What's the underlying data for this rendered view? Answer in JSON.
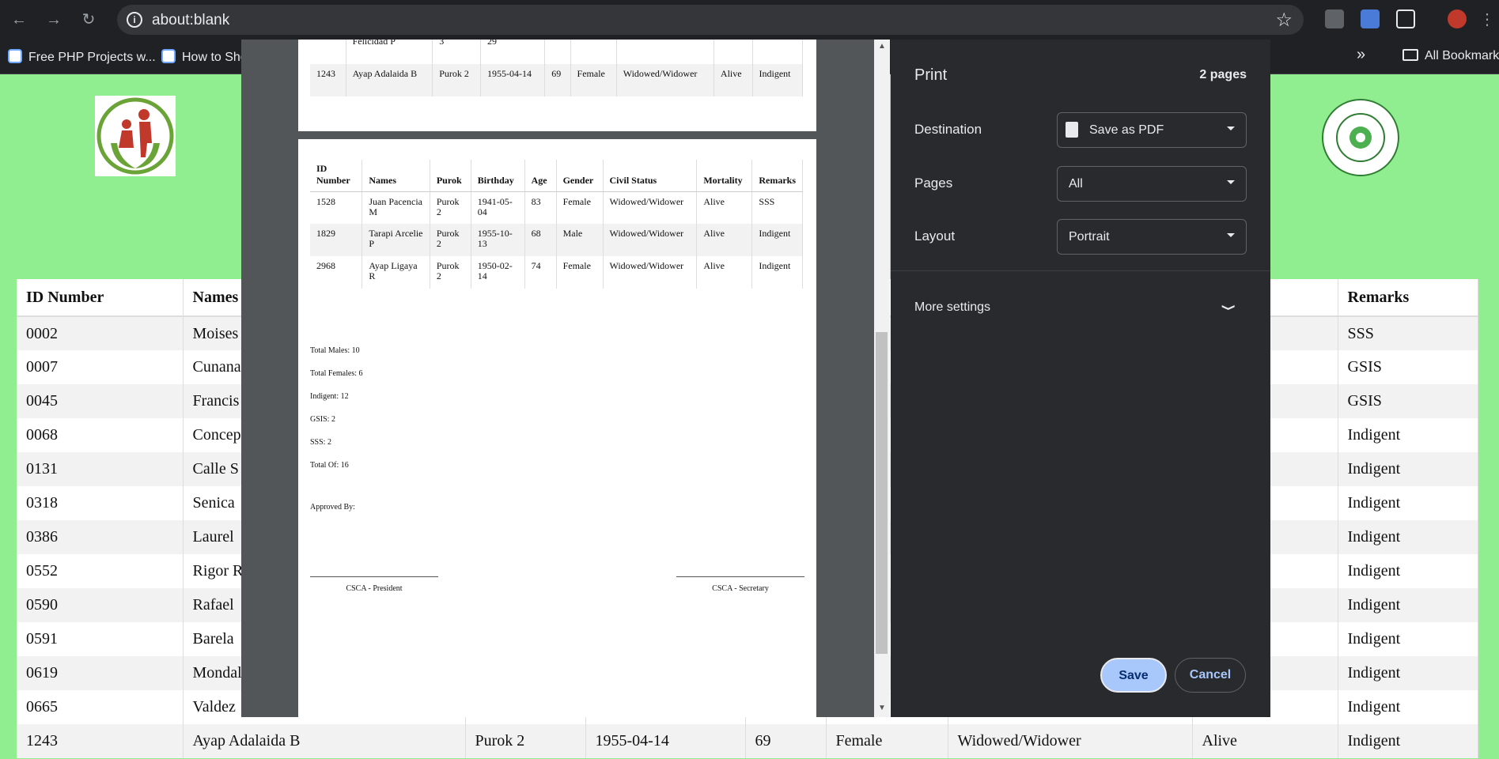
{
  "browser": {
    "url": "about:blank",
    "bookmarks": [
      "Free PHP Projects w...",
      "How to Sho"
    ],
    "all_bookmarks": "All Bookmarks",
    "overflow": "»"
  },
  "bg_table": {
    "headers": [
      "ID Number",
      "Names",
      "",
      "",
      "",
      "",
      "",
      "",
      "Remarks"
    ],
    "rows": [
      [
        "0002",
        "Moises",
        "",
        "",
        "",
        "",
        "",
        "",
        "SSS"
      ],
      [
        "0007",
        "Cunana",
        "",
        "",
        "",
        "",
        "",
        "",
        "GSIS"
      ],
      [
        "0045",
        "Francis",
        "",
        "",
        "",
        "",
        "",
        "",
        "GSIS"
      ],
      [
        "0068",
        "Concep",
        "",
        "",
        "",
        "",
        "",
        "",
        "Indigent"
      ],
      [
        "0131",
        "Calle S",
        "",
        "",
        "",
        "",
        "",
        "",
        "Indigent"
      ],
      [
        "0318",
        "Senica",
        "",
        "",
        "",
        "",
        "",
        "",
        "Indigent"
      ],
      [
        "0386",
        "Laurel",
        "",
        "",
        "",
        "",
        "",
        "",
        "Indigent"
      ],
      [
        "0552",
        "Rigor R",
        "",
        "",
        "",
        "",
        "",
        "",
        "Indigent"
      ],
      [
        "0590",
        "Rafael",
        "",
        "",
        "",
        "",
        "",
        "",
        "Indigent"
      ],
      [
        "0591",
        "Barela",
        "",
        "",
        "",
        "",
        "",
        "",
        "Indigent"
      ],
      [
        "0619",
        "Mondal",
        "",
        "",
        "",
        "",
        "",
        "",
        "Indigent"
      ],
      [
        "0665",
        "Valdez",
        "",
        "",
        "",
        "",
        "",
        "",
        "Indigent"
      ],
      [
        "1243",
        "Ayap Adalaida B",
        "Purok 2",
        "1955-04-14",
        "69",
        "Female",
        "Widowed/Widower",
        "Alive",
        "Indigent"
      ]
    ]
  },
  "preview": {
    "page1_rows": [
      [
        "",
        "Felicidad P",
        "3",
        "29",
        "",
        "",
        "",
        "",
        ""
      ],
      [
        "1243",
        "Ayap Adalaida B",
        "Purok 2",
        "1955-04-14",
        "69",
        "Female",
        "Widowed/Widower",
        "Alive",
        "Indigent"
      ]
    ],
    "headers": [
      "ID Number",
      "Names",
      "Purok",
      "Birthday",
      "Age",
      "Gender",
      "Civil Status",
      "Mortality",
      "Remarks"
    ],
    "page2_rows": [
      [
        "1528",
        "Juan Pacencia M",
        "Purok 2",
        "1941-05-04",
        "83",
        "Female",
        "Widowed/Widower",
        "Alive",
        "SSS"
      ],
      [
        "1829",
        "Tarapi Arcelie P",
        "Purok 2",
        "1955-10-13",
        "68",
        "Male",
        "Widowed/Widower",
        "Alive",
        "Indigent"
      ],
      [
        "2968",
        "Ayap Ligaya R",
        "Purok 2",
        "1950-02-14",
        "74",
        "Female",
        "Widowed/Widower",
        "Alive",
        "Indigent"
      ]
    ],
    "totals": [
      "Total Males: 10",
      "Total Females: 6",
      "Indigent: 12",
      "GSIS: 2",
      "SSS: 2",
      "Total Of: 16"
    ],
    "approved_by": "Approved By:",
    "president": "CSCA - President",
    "secretary": "CSCA - Secretary"
  },
  "dialog": {
    "title": "Print",
    "page_count": "2 pages",
    "destination_label": "Destination",
    "destination_value": "Save as PDF",
    "pages_label": "Pages",
    "pages_value": "All",
    "layout_label": "Layout",
    "layout_value": "Portrait",
    "more_settings": "More settings",
    "save": "Save",
    "cancel": "Cancel"
  }
}
